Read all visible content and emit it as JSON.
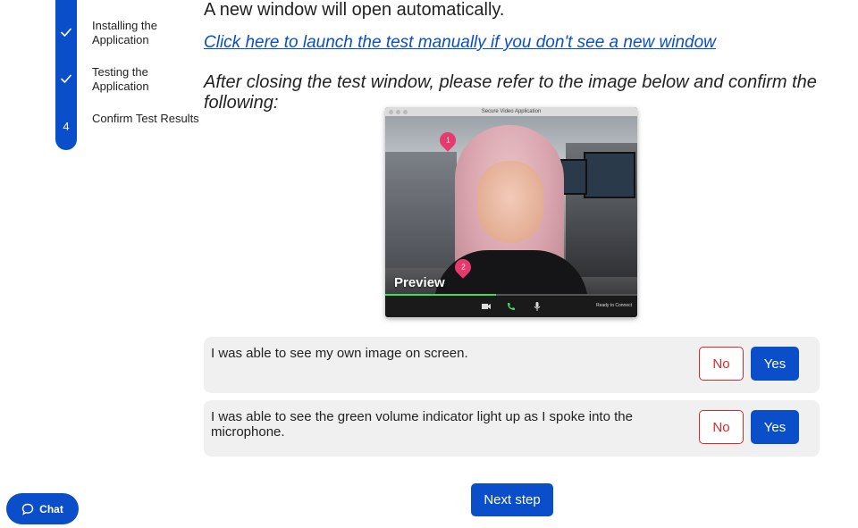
{
  "stepper": {
    "steps": [
      {
        "label": "Installing the Application",
        "status": "complete",
        "marker": "check-icon"
      },
      {
        "label": "Testing the Application",
        "status": "complete",
        "marker": "check-icon"
      },
      {
        "label": "Confirm Test Results",
        "status": "current",
        "marker": "4"
      }
    ]
  },
  "main": {
    "intro": "A new window will open automatically.",
    "launch_link": "Click here to launch the test manually if you don't see a new window",
    "instruction": "After closing the test window, please refer to the image below and confirm the following:"
  },
  "video_app": {
    "window_title": "Secure Video Application",
    "preview_label": "Preview",
    "status_text": "Ready to Connect",
    "pin_1": "1",
    "pin_2": "2",
    "volume_level_percent": 44,
    "controls": [
      "video-camera-icon",
      "phone-icon",
      "microphone-icon"
    ]
  },
  "confirmations": [
    {
      "text": "I was able to see my own image on screen.",
      "no_label": "No",
      "yes_label": "Yes"
    },
    {
      "text": "I was able to see the green volume indicator light up as I spoke into the microphone.",
      "no_label": "No",
      "yes_label": "Yes"
    }
  ],
  "next_button": "Next step",
  "chat_button": "Chat",
  "colors": {
    "primary": "#0a4fc9",
    "danger": "#d62a2a",
    "card_bg": "#f0f0f0",
    "pin": "#e63a6e",
    "volume": "#3ddc5a"
  }
}
